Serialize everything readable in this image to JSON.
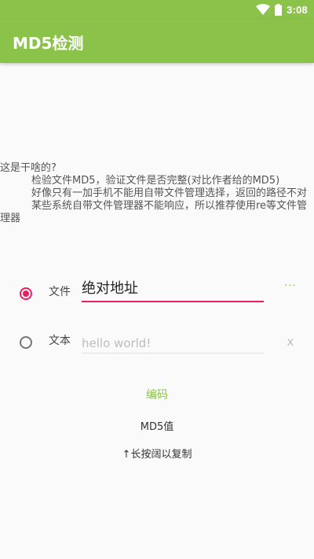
{
  "status_bar": {
    "time": "3:08",
    "icons": [
      "wifi-icon",
      "battery-icon"
    ],
    "background": "#8bc34a"
  },
  "app_bar": {
    "title": "MD5检测",
    "background": "#8bc34a"
  },
  "description": {
    "line1": "这是干啥的?",
    "line2": "检验文件MD5，验证文件是否完整(对比作者给的MD5)",
    "line3": "好像只有一加手机不能用自带文件管理选择，返回的路径不对",
    "line4": "某些系统自带文件管理器不能响应，所以推荐使用re等文件管理器"
  },
  "file_option": {
    "label": "文件",
    "value": "绝对地址",
    "selected": true,
    "more_label": "···"
  },
  "text_option": {
    "label": "文本",
    "placeholder": "hello world!",
    "value": "",
    "selected": false,
    "clear_label": "x"
  },
  "actions": {
    "encode_label": "编码",
    "md5_label": "MD5值",
    "copy_hint": "↑长按阔以复制"
  },
  "colors": {
    "accent": "#e91e63",
    "primary": "#8bc34a"
  }
}
